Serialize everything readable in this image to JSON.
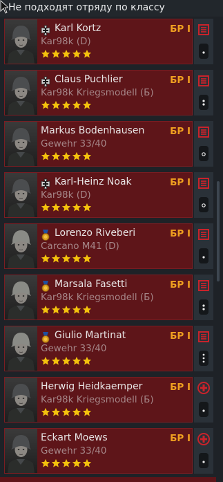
{
  "header": {
    "title": "Не подходят отряду по классу"
  },
  "colors": {
    "card_bg": "#5e1519",
    "br": "#f0a020",
    "stars": "#f4c20d",
    "weapon": "#a58688"
  },
  "soldiers": [
    {
      "name": "Karl Kortz",
      "weapon": "Kar98k (D)",
      "br": "БР I",
      "award": "iron-cross-icon",
      "stars": 5,
      "side_icon": "engineer-kit-icon"
    },
    {
      "name": "Claus Puchlier",
      "weapon": "Kar98k Kriegsmodell (Б)",
      "br": "БР I",
      "award": "iron-cross-icon",
      "stars": 5,
      "side_icon": "engineer-kit-icon"
    },
    {
      "name": "Markus Bodenhausen",
      "weapon": "Gewehr 33/40",
      "br": "БР I",
      "award": "",
      "stars": 5,
      "side_icon": "engineer-kit-icon"
    },
    {
      "name": "Karl-Heinz Noak",
      "weapon": "Kar98k (D)",
      "br": "БР I",
      "award": "iron-cross-icon",
      "stars": 5,
      "side_icon": "engineer-kit-icon"
    },
    {
      "name": "Lorenzo Riveberi",
      "weapon": "Carcano M41 (D)",
      "br": "БР I",
      "award": "medal-icon",
      "stars": 5,
      "side_icon": "engineer-kit-icon"
    },
    {
      "name": "Marsala Fasetti",
      "weapon": "Kar98k Kriegsmodell (Б)",
      "br": "БР I",
      "award": "medal-icon",
      "stars": 5,
      "side_icon": "engineer-kit-icon"
    },
    {
      "name": "Giulio Martinat",
      "weapon": "Gewehr 33/40",
      "br": "БР I",
      "award": "medal-icon",
      "stars": 5,
      "side_icon": "engineer-kit-icon"
    },
    {
      "name": "Herwig Heidkaemper",
      "weapon": "Kar98k Kriegsmodell (Б)",
      "br": "БР I",
      "award": "",
      "stars": 5,
      "side_icon": "medic-cross-icon"
    },
    {
      "name": "Eckart Moews",
      "weapon": "Gewehr 33/40",
      "br": "БР I",
      "award": "",
      "stars": 5,
      "side_icon": "medic-cross-icon"
    }
  ]
}
